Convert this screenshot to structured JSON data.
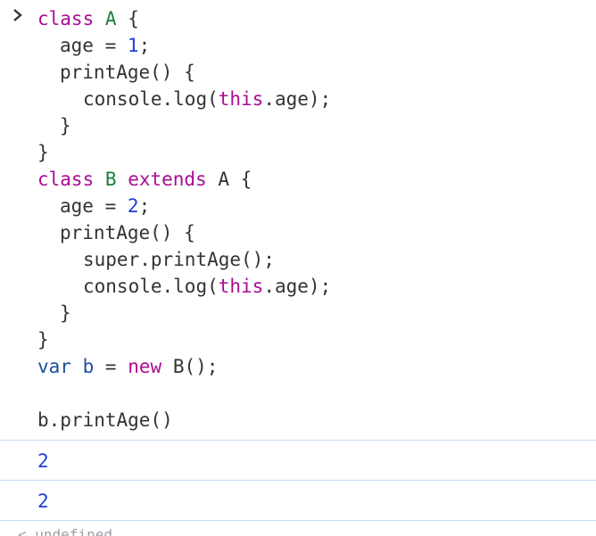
{
  "console": {
    "input": {
      "line1": {
        "kw": "class",
        "name": "A",
        "brace": "{"
      },
      "line2": {
        "prop": "age",
        "op": "=",
        "num": "1",
        "semi": ";"
      },
      "line3": {
        "method": "printAge",
        "parens": "()",
        "brace": "{"
      },
      "line4": {
        "obj": "console.",
        "fn": "log",
        "open": "(",
        "kw": "this",
        "rest": ".age);"
      },
      "line5": {
        "brace": "}"
      },
      "line6": {
        "brace": "}"
      },
      "line7": {
        "kw": "class",
        "name": "B",
        "kw2": "extends",
        "parent": "A",
        "brace": "{"
      },
      "line8": {
        "prop": "age",
        "op": "=",
        "num": "2",
        "semi": ";"
      },
      "line9": {
        "method": "printAge",
        "parens": "()",
        "brace": "{"
      },
      "line10": {
        "text": "super.printAge();"
      },
      "line11": {
        "obj": "console.",
        "fn": "log",
        "open": "(",
        "kw": "this",
        "rest": ".age);"
      },
      "line12": {
        "brace": "}"
      },
      "line13": {
        "brace": "}"
      },
      "line14": {
        "kw": "var",
        "name": "b",
        "op": "=",
        "kw2": "new",
        "rest": "B();"
      },
      "line16": {
        "text": "b.printAge()"
      }
    },
    "outputs": [
      "2",
      "2"
    ],
    "cut_text": "< undefined"
  },
  "colors": {
    "keyword": "#aa0d91",
    "class_name": "#1a7f37",
    "number": "#1c3fd6",
    "variable": "#1b4f9c",
    "divider": "#c9dcef"
  }
}
